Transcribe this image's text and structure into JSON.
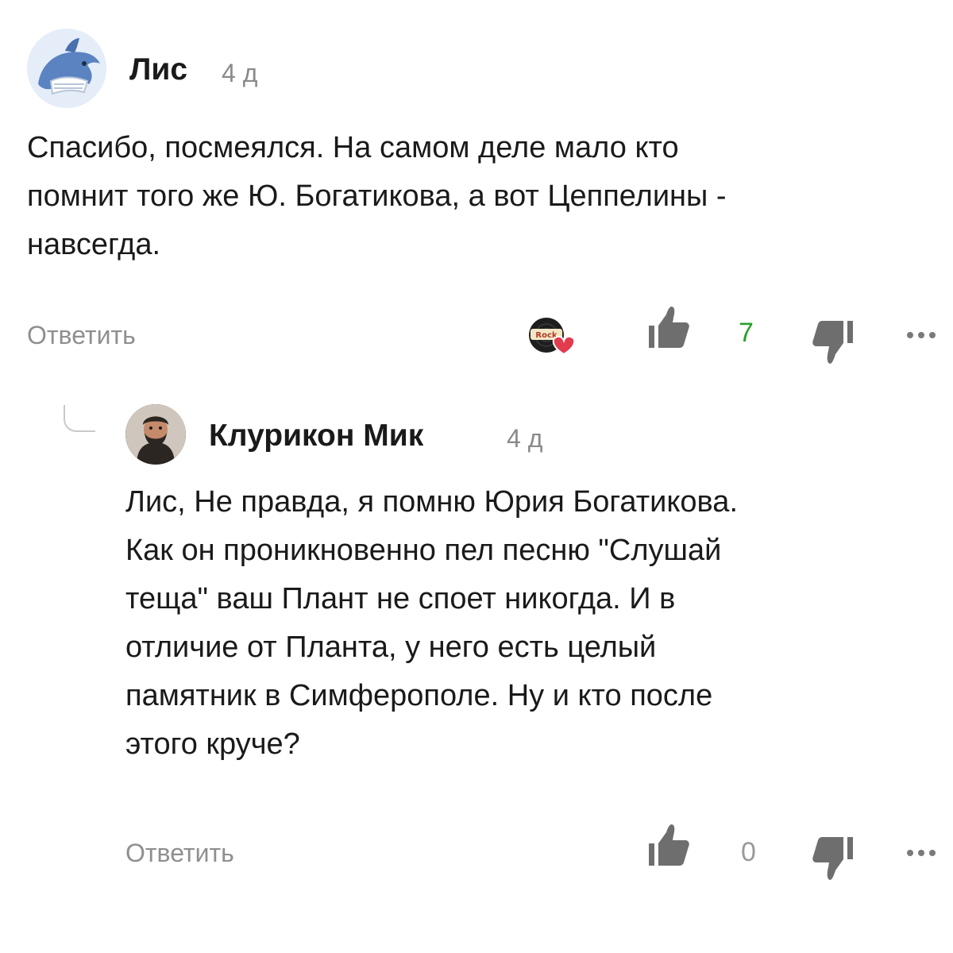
{
  "comments": [
    {
      "author": "Лис",
      "time": "4 д",
      "text_lines": [
        "Спасибо, посмеялся. На самом деле мало кто",
        "помнит того же Ю. Богатикова, а вот Цеппелины -",
        "навсегда."
      ],
      "reply_label": "Ответить",
      "likes": "7",
      "badge_text": "Rock"
    },
    {
      "author": "Клурикон Мик",
      "time": "4 д",
      "text_lines": [
        "Лис, Не правда, я помню Юрия Богатикова.",
        "Как он проникновенно пел песню \"Слушай",
        "теща\" ваш Плант не споет никогда. И в",
        "отличие от Планта, у него есть целый",
        "памятник в Симферополе. Ну и кто после",
        "этого круче?"
      ],
      "reply_label": "Ответить",
      "likes": "0"
    }
  ],
  "colors": {
    "like_positive": "#2aa02a",
    "muted": "#8f8f8f",
    "icon_gray": "#6e6e6e"
  }
}
